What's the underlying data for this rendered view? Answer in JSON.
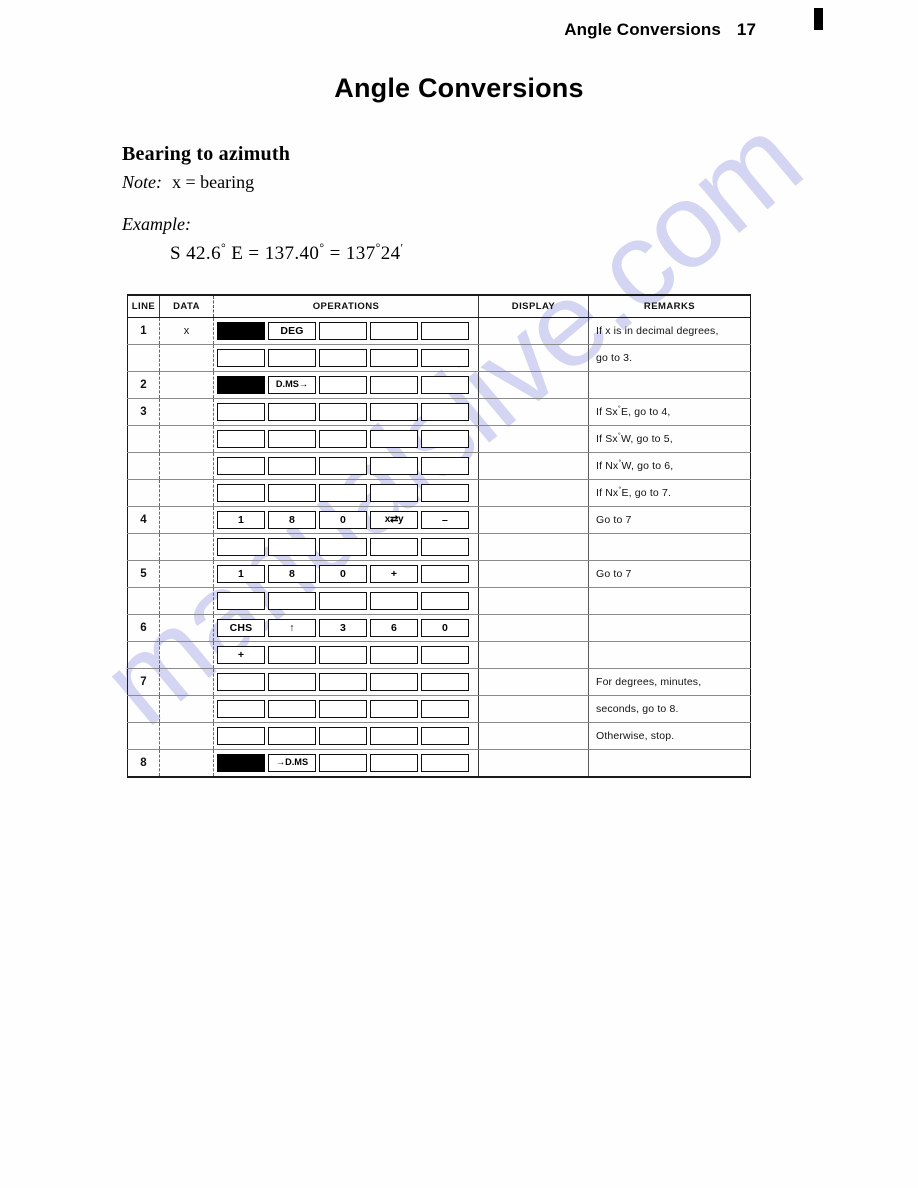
{
  "running_head": {
    "title": "Angle Conversions",
    "page_number": "17"
  },
  "main_title": "Angle Conversions",
  "section_heading": "Bearing to azimuth",
  "note": {
    "label": "Note:",
    "text": "x = bearing"
  },
  "example": {
    "label": "Example:",
    "expression_plain": "S 42.6° E = 137.40° = 137°24′",
    "parts": {
      "bearing": "S 42.6",
      "deg1": "°",
      "dir": "E",
      "eq1": "=",
      "decimal": "137.40",
      "deg2": "°",
      "eq2": "=",
      "dms_deg": "137",
      "deg3": "°",
      "dms_min": "24",
      "prime": "′"
    }
  },
  "table": {
    "headers": {
      "line": "LINE",
      "data": "DATA",
      "operations": "OPERATIONS",
      "display": "DISPLAY",
      "remarks": "REMARKS"
    },
    "rows": [
      {
        "line": "1",
        "data": "x",
        "keys": [
          {
            "label": "",
            "style": "filled"
          },
          {
            "label": "DEG",
            "style": "normal"
          },
          {
            "label": "",
            "style": "empty"
          },
          {
            "label": "",
            "style": "empty"
          },
          {
            "label": "",
            "style": "empty"
          }
        ],
        "display": "",
        "remarks": "If x is in decimal degrees,"
      },
      {
        "line": "",
        "data": "",
        "keys": [
          {
            "label": "",
            "style": "empty"
          },
          {
            "label": "",
            "style": "empty"
          },
          {
            "label": "",
            "style": "empty"
          },
          {
            "label": "",
            "style": "empty"
          },
          {
            "label": "",
            "style": "empty"
          }
        ],
        "display": "",
        "remarks": "go to 3."
      },
      {
        "line": "2",
        "data": "",
        "keys": [
          {
            "label": "",
            "style": "filled"
          },
          {
            "label": "D.MS→",
            "style": "small"
          },
          {
            "label": "",
            "style": "empty"
          },
          {
            "label": "",
            "style": "empty"
          },
          {
            "label": "",
            "style": "empty"
          }
        ],
        "display": "",
        "remarks": ""
      },
      {
        "line": "3",
        "data": "",
        "keys": [
          {
            "label": "",
            "style": "empty"
          },
          {
            "label": "",
            "style": "empty"
          },
          {
            "label": "",
            "style": "empty"
          },
          {
            "label": "",
            "style": "empty"
          },
          {
            "label": "",
            "style": "empty"
          }
        ],
        "display": "",
        "remarks_html": "If Sx<sup>°</sup>E, go to 4,"
      },
      {
        "line": "",
        "data": "",
        "keys": [
          {
            "label": "",
            "style": "empty"
          },
          {
            "label": "",
            "style": "empty"
          },
          {
            "label": "",
            "style": "empty"
          },
          {
            "label": "",
            "style": "empty"
          },
          {
            "label": "",
            "style": "empty"
          }
        ],
        "display": "",
        "remarks_html": "If Sx<sup>°</sup>W, go to 5,"
      },
      {
        "line": "",
        "data": "",
        "keys": [
          {
            "label": "",
            "style": "empty"
          },
          {
            "label": "",
            "style": "empty"
          },
          {
            "label": "",
            "style": "empty"
          },
          {
            "label": "",
            "style": "empty"
          },
          {
            "label": "",
            "style": "empty"
          }
        ],
        "display": "",
        "remarks_html": "If Nx<sup>°</sup>W, go to 6,"
      },
      {
        "line": "",
        "data": "",
        "keys": [
          {
            "label": "",
            "style": "empty"
          },
          {
            "label": "",
            "style": "empty"
          },
          {
            "label": "",
            "style": "empty"
          },
          {
            "label": "",
            "style": "empty"
          },
          {
            "label": "",
            "style": "empty"
          }
        ],
        "display": "",
        "remarks_html": "If Nx<sup>°</sup>E, go to 7."
      },
      {
        "line": "4",
        "data": "",
        "keys": [
          {
            "label": "1",
            "style": "normal"
          },
          {
            "label": "8",
            "style": "normal"
          },
          {
            "label": "0",
            "style": "normal"
          },
          {
            "label": "x⇄y",
            "style": "swap"
          },
          {
            "label": "–",
            "style": "normal"
          }
        ],
        "display": "",
        "remarks": "Go to 7"
      },
      {
        "line": "",
        "data": "",
        "keys": [
          {
            "label": "",
            "style": "empty"
          },
          {
            "label": "",
            "style": "empty"
          },
          {
            "label": "",
            "style": "empty"
          },
          {
            "label": "",
            "style": "empty"
          },
          {
            "label": "",
            "style": "empty"
          }
        ],
        "display": "",
        "remarks": ""
      },
      {
        "line": "5",
        "data": "",
        "keys": [
          {
            "label": "1",
            "style": "normal"
          },
          {
            "label": "8",
            "style": "normal"
          },
          {
            "label": "0",
            "style": "normal"
          },
          {
            "label": "+",
            "style": "normal"
          },
          {
            "label": "",
            "style": "empty"
          }
        ],
        "display": "",
        "remarks": "Go to 7"
      },
      {
        "line": "",
        "data": "",
        "keys": [
          {
            "label": "",
            "style": "empty"
          },
          {
            "label": "",
            "style": "empty"
          },
          {
            "label": "",
            "style": "empty"
          },
          {
            "label": "",
            "style": "empty"
          },
          {
            "label": "",
            "style": "empty"
          }
        ],
        "display": "",
        "remarks": ""
      },
      {
        "line": "6",
        "data": "",
        "keys": [
          {
            "label": "CHS",
            "style": "normal"
          },
          {
            "label": "↑",
            "style": "normal"
          },
          {
            "label": "3",
            "style": "normal"
          },
          {
            "label": "6",
            "style": "normal"
          },
          {
            "label": "0",
            "style": "normal"
          }
        ],
        "display": "",
        "remarks": ""
      },
      {
        "line": "",
        "data": "",
        "keys": [
          {
            "label": "+",
            "style": "normal"
          },
          {
            "label": "",
            "style": "empty"
          },
          {
            "label": "",
            "style": "empty"
          },
          {
            "label": "",
            "style": "empty"
          },
          {
            "label": "",
            "style": "empty"
          }
        ],
        "display": "",
        "remarks": ""
      },
      {
        "line": "7",
        "data": "",
        "keys": [
          {
            "label": "",
            "style": "empty"
          },
          {
            "label": "",
            "style": "empty"
          },
          {
            "label": "",
            "style": "empty"
          },
          {
            "label": "",
            "style": "empty"
          },
          {
            "label": "",
            "style": "empty"
          }
        ],
        "display": "",
        "remarks": "For degrees, minutes,"
      },
      {
        "line": "",
        "data": "",
        "keys": [
          {
            "label": "",
            "style": "empty"
          },
          {
            "label": "",
            "style": "empty"
          },
          {
            "label": "",
            "style": "empty"
          },
          {
            "label": "",
            "style": "empty"
          },
          {
            "label": "",
            "style": "empty"
          }
        ],
        "display": "",
        "remarks": "seconds, go to 8."
      },
      {
        "line": "",
        "data": "",
        "keys": [
          {
            "label": "",
            "style": "empty"
          },
          {
            "label": "",
            "style": "empty"
          },
          {
            "label": "",
            "style": "empty"
          },
          {
            "label": "",
            "style": "empty"
          },
          {
            "label": "",
            "style": "empty"
          }
        ],
        "display": "",
        "remarks": "Otherwise, stop."
      },
      {
        "line": "8",
        "data": "",
        "keys": [
          {
            "label": "",
            "style": "filled"
          },
          {
            "label": "→D.MS",
            "style": "small"
          },
          {
            "label": "",
            "style": "empty"
          },
          {
            "label": "",
            "style": "empty"
          },
          {
            "label": "",
            "style": "empty"
          }
        ],
        "display": "",
        "remarks": ""
      }
    ]
  },
  "watermark": {
    "text": "manualslive.com",
    "color": "#c3c6ee"
  },
  "marks": {
    "thumb_index": "thumb-index-bar"
  }
}
